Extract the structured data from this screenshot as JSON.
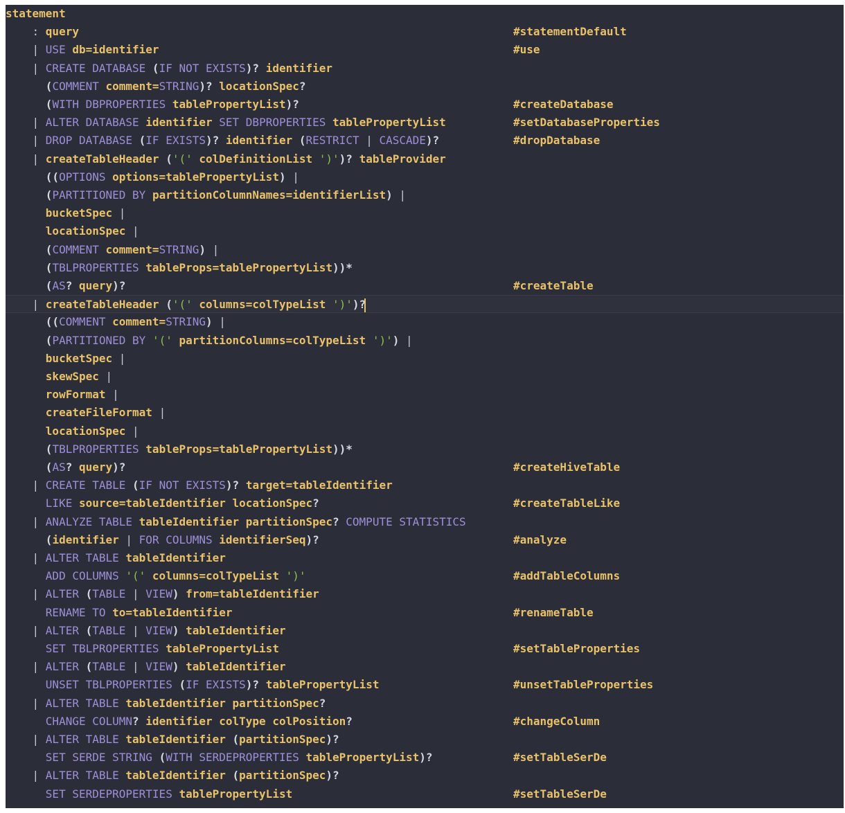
{
  "editor": {
    "lines": [
      {
        "indent": "",
        "tokens": [
          [
            "r",
            "statement"
          ]
        ],
        "label": ""
      },
      {
        "indent": "    ",
        "tokens": [
          [
            "s",
            ": "
          ],
          [
            "r",
            "query"
          ]
        ],
        "label": "#statementDefault"
      },
      {
        "indent": "    ",
        "tokens": [
          [
            "s",
            "| "
          ],
          [
            "k",
            "USE "
          ],
          [
            "r",
            "db=identifier"
          ]
        ],
        "label": "#use"
      },
      {
        "indent": "    ",
        "tokens": [
          [
            "s",
            "| "
          ],
          [
            "k",
            "CREATE DATABASE "
          ],
          [
            "p",
            "("
          ],
          [
            "k",
            "IF NOT EXISTS"
          ],
          [
            "p",
            ")? "
          ],
          [
            "r",
            "identifier"
          ]
        ],
        "label": ""
      },
      {
        "indent": "      ",
        "tokens": [
          [
            "p",
            "("
          ],
          [
            "k",
            "COMMENT "
          ],
          [
            "r",
            "comment="
          ],
          [
            "k",
            "STRING"
          ],
          [
            "p",
            ")? "
          ],
          [
            "r",
            "locationSpec"
          ],
          [
            "p",
            "?"
          ]
        ],
        "label": ""
      },
      {
        "indent": "      ",
        "tokens": [
          [
            "p",
            "("
          ],
          [
            "k",
            "WITH DBPROPERTIES "
          ],
          [
            "r",
            "tablePropertyList"
          ],
          [
            "p",
            ")?"
          ]
        ],
        "label": "#createDatabase"
      },
      {
        "indent": "    ",
        "tokens": [
          [
            "s",
            "| "
          ],
          [
            "k",
            "ALTER DATABASE "
          ],
          [
            "r",
            "identifier "
          ],
          [
            "k",
            "SET DBPROPERTIES "
          ],
          [
            "r",
            "tablePropertyList"
          ]
        ],
        "label": "#setDatabaseProperties"
      },
      {
        "indent": "    ",
        "tokens": [
          [
            "s",
            "| "
          ],
          [
            "k",
            "DROP DATABASE "
          ],
          [
            "p",
            "("
          ],
          [
            "k",
            "IF EXISTS"
          ],
          [
            "p",
            ")? "
          ],
          [
            "r",
            "identifier "
          ],
          [
            "p",
            "("
          ],
          [
            "k",
            "RESTRICT "
          ],
          [
            "s",
            "| "
          ],
          [
            "k",
            "CASCADE"
          ],
          [
            "p",
            ")?"
          ]
        ],
        "label": "#dropDatabase"
      },
      {
        "indent": "    ",
        "tokens": [
          [
            "s",
            "| "
          ],
          [
            "r",
            "createTableHeader "
          ],
          [
            "p",
            "("
          ],
          [
            "t",
            "'(' "
          ],
          [
            "r",
            "colDefinitionList "
          ],
          [
            "t",
            "')'"
          ],
          [
            "p",
            ")? "
          ],
          [
            "r",
            "tableProvider"
          ]
        ],
        "label": ""
      },
      {
        "indent": "      ",
        "tokens": [
          [
            "p",
            "(("
          ],
          [
            "k",
            "OPTIONS "
          ],
          [
            "r",
            "options=tablePropertyList"
          ],
          [
            "p",
            ") "
          ],
          [
            "s",
            "|"
          ]
        ],
        "label": ""
      },
      {
        "indent": "      ",
        "tokens": [
          [
            "p",
            "("
          ],
          [
            "k",
            "PARTITIONED BY "
          ],
          [
            "r",
            "partitionColumnNames=identifierList"
          ],
          [
            "p",
            ") "
          ],
          [
            "s",
            "|"
          ]
        ],
        "label": ""
      },
      {
        "indent": "      ",
        "tokens": [
          [
            "r",
            "bucketSpec "
          ],
          [
            "s",
            "|"
          ]
        ],
        "label": ""
      },
      {
        "indent": "      ",
        "tokens": [
          [
            "r",
            "locationSpec "
          ],
          [
            "s",
            "|"
          ]
        ],
        "label": ""
      },
      {
        "indent": "      ",
        "tokens": [
          [
            "p",
            "("
          ],
          [
            "k",
            "COMMENT "
          ],
          [
            "r",
            "comment="
          ],
          [
            "k",
            "STRING"
          ],
          [
            "p",
            ") "
          ],
          [
            "s",
            "|"
          ]
        ],
        "label": ""
      },
      {
        "indent": "      ",
        "tokens": [
          [
            "p",
            "("
          ],
          [
            "k",
            "TBLPROPERTIES "
          ],
          [
            "r",
            "tableProps=tablePropertyList"
          ],
          [
            "p",
            "))*"
          ]
        ],
        "label": ""
      },
      {
        "indent": "      ",
        "tokens": [
          [
            "p",
            "("
          ],
          [
            "k",
            "AS"
          ],
          [
            "p",
            "? "
          ],
          [
            "r",
            "query"
          ],
          [
            "p",
            ")?"
          ]
        ],
        "label": "#createTable"
      },
      {
        "indent": "    ",
        "tokens": [
          [
            "s",
            "| "
          ],
          [
            "r",
            "createTableHeader "
          ],
          [
            "p",
            "("
          ],
          [
            "t",
            "'(' "
          ],
          [
            "r",
            "columns=colTypeList "
          ],
          [
            "t",
            "')'"
          ],
          [
            "p",
            ")?"
          ]
        ],
        "label": "",
        "current": true
      },
      {
        "indent": "      ",
        "tokens": [
          [
            "p",
            "(("
          ],
          [
            "k",
            "COMMENT "
          ],
          [
            "r",
            "comment="
          ],
          [
            "k",
            "STRING"
          ],
          [
            "p",
            ") "
          ],
          [
            "s",
            "|"
          ]
        ],
        "label": ""
      },
      {
        "indent": "      ",
        "tokens": [
          [
            "p",
            "("
          ],
          [
            "k",
            "PARTITIONED BY "
          ],
          [
            "t",
            "'(' "
          ],
          [
            "r",
            "partitionColumns=colTypeList "
          ],
          [
            "t",
            "')'"
          ],
          [
            "p",
            ") "
          ],
          [
            "s",
            "|"
          ]
        ],
        "label": ""
      },
      {
        "indent": "      ",
        "tokens": [
          [
            "r",
            "bucketSpec "
          ],
          [
            "s",
            "|"
          ]
        ],
        "label": ""
      },
      {
        "indent": "      ",
        "tokens": [
          [
            "r",
            "skewSpec "
          ],
          [
            "s",
            "|"
          ]
        ],
        "label": ""
      },
      {
        "indent": "      ",
        "tokens": [
          [
            "r",
            "rowFormat "
          ],
          [
            "s",
            "|"
          ]
        ],
        "label": ""
      },
      {
        "indent": "      ",
        "tokens": [
          [
            "r",
            "createFileFormat "
          ],
          [
            "s",
            "|"
          ]
        ],
        "label": ""
      },
      {
        "indent": "      ",
        "tokens": [
          [
            "r",
            "locationSpec "
          ],
          [
            "s",
            "|"
          ]
        ],
        "label": ""
      },
      {
        "indent": "      ",
        "tokens": [
          [
            "p",
            "("
          ],
          [
            "k",
            "TBLPROPERTIES "
          ],
          [
            "r",
            "tableProps=tablePropertyList"
          ],
          [
            "p",
            "))*"
          ]
        ],
        "label": ""
      },
      {
        "indent": "      ",
        "tokens": [
          [
            "p",
            "("
          ],
          [
            "k",
            "AS"
          ],
          [
            "p",
            "? "
          ],
          [
            "r",
            "query"
          ],
          [
            "p",
            ")?"
          ]
        ],
        "label": "#createHiveTable"
      },
      {
        "indent": "    ",
        "tokens": [
          [
            "s",
            "| "
          ],
          [
            "k",
            "CREATE TABLE "
          ],
          [
            "p",
            "("
          ],
          [
            "k",
            "IF NOT EXISTS"
          ],
          [
            "p",
            ")? "
          ],
          [
            "r",
            "target=tableIdentifier"
          ]
        ],
        "label": ""
      },
      {
        "indent": "      ",
        "tokens": [
          [
            "k",
            "LIKE "
          ],
          [
            "r",
            "source=tableIdentifier locationSpec"
          ],
          [
            "p",
            "?"
          ]
        ],
        "label": "#createTableLike"
      },
      {
        "indent": "    ",
        "tokens": [
          [
            "s",
            "| "
          ],
          [
            "k",
            "ANALYZE TABLE "
          ],
          [
            "r",
            "tableIdentifier partitionSpec"
          ],
          [
            "p",
            "? "
          ],
          [
            "k",
            "COMPUTE STATISTICS"
          ]
        ],
        "label": ""
      },
      {
        "indent": "      ",
        "tokens": [
          [
            "p",
            "("
          ],
          [
            "r",
            "identifier "
          ],
          [
            "s",
            "| "
          ],
          [
            "k",
            "FOR COLUMNS "
          ],
          [
            "r",
            "identifierSeq"
          ],
          [
            "p",
            ")?"
          ]
        ],
        "label": "#analyze"
      },
      {
        "indent": "    ",
        "tokens": [
          [
            "s",
            "| "
          ],
          [
            "k",
            "ALTER TABLE "
          ],
          [
            "r",
            "tableIdentifier"
          ]
        ],
        "label": ""
      },
      {
        "indent": "      ",
        "tokens": [
          [
            "k",
            "ADD COLUMNS "
          ],
          [
            "t",
            "'(' "
          ],
          [
            "r",
            "columns=colTypeList "
          ],
          [
            "t",
            "')'"
          ]
        ],
        "label": "#addTableColumns"
      },
      {
        "indent": "    ",
        "tokens": [
          [
            "s",
            "| "
          ],
          [
            "k",
            "ALTER "
          ],
          [
            "p",
            "("
          ],
          [
            "k",
            "TABLE "
          ],
          [
            "s",
            "| "
          ],
          [
            "k",
            "VIEW"
          ],
          [
            "p",
            ") "
          ],
          [
            "r",
            "from=tableIdentifier"
          ]
        ],
        "label": ""
      },
      {
        "indent": "      ",
        "tokens": [
          [
            "k",
            "RENAME TO "
          ],
          [
            "r",
            "to=tableIdentifier"
          ]
        ],
        "label": "#renameTable"
      },
      {
        "indent": "    ",
        "tokens": [
          [
            "s",
            "| "
          ],
          [
            "k",
            "ALTER "
          ],
          [
            "p",
            "("
          ],
          [
            "k",
            "TABLE "
          ],
          [
            "s",
            "| "
          ],
          [
            "k",
            "VIEW"
          ],
          [
            "p",
            ") "
          ],
          [
            "r",
            "tableIdentifier"
          ]
        ],
        "label": ""
      },
      {
        "indent": "      ",
        "tokens": [
          [
            "k",
            "SET TBLPROPERTIES "
          ],
          [
            "r",
            "tablePropertyList"
          ]
        ],
        "label": "#setTableProperties"
      },
      {
        "indent": "    ",
        "tokens": [
          [
            "s",
            "| "
          ],
          [
            "k",
            "ALTER "
          ],
          [
            "p",
            "("
          ],
          [
            "k",
            "TABLE "
          ],
          [
            "s",
            "| "
          ],
          [
            "k",
            "VIEW"
          ],
          [
            "p",
            ") "
          ],
          [
            "r",
            "tableIdentifier"
          ]
        ],
        "label": ""
      },
      {
        "indent": "      ",
        "tokens": [
          [
            "k",
            "UNSET TBLPROPERTIES "
          ],
          [
            "p",
            "("
          ],
          [
            "k",
            "IF EXISTS"
          ],
          [
            "p",
            ")? "
          ],
          [
            "r",
            "tablePropertyList"
          ]
        ],
        "label": "#unsetTableProperties"
      },
      {
        "indent": "    ",
        "tokens": [
          [
            "s",
            "| "
          ],
          [
            "k",
            "ALTER TABLE "
          ],
          [
            "r",
            "tableIdentifier partitionSpec"
          ],
          [
            "p",
            "?"
          ]
        ],
        "label": ""
      },
      {
        "indent": "      ",
        "tokens": [
          [
            "k",
            "CHANGE COLUMN"
          ],
          [
            "p",
            "? "
          ],
          [
            "r",
            "identifier colType colPosition"
          ],
          [
            "p",
            "?"
          ]
        ],
        "label": "#changeColumn"
      },
      {
        "indent": "    ",
        "tokens": [
          [
            "s",
            "| "
          ],
          [
            "k",
            "ALTER TABLE "
          ],
          [
            "r",
            "tableIdentifier "
          ],
          [
            "p",
            "("
          ],
          [
            "r",
            "partitionSpec"
          ],
          [
            "p",
            ")?"
          ]
        ],
        "label": ""
      },
      {
        "indent": "      ",
        "tokens": [
          [
            "k",
            "SET SERDE STRING "
          ],
          [
            "p",
            "("
          ],
          [
            "k",
            "WITH SERDEPROPERTIES "
          ],
          [
            "r",
            "tablePropertyList"
          ],
          [
            "p",
            ")?"
          ]
        ],
        "label": "#setTableSerDe"
      },
      {
        "indent": "    ",
        "tokens": [
          [
            "s",
            "| "
          ],
          [
            "k",
            "ALTER TABLE "
          ],
          [
            "r",
            "tableIdentifier "
          ],
          [
            "p",
            "("
          ],
          [
            "r",
            "partitionSpec"
          ],
          [
            "p",
            ")?"
          ]
        ],
        "label": ""
      },
      {
        "indent": "      ",
        "tokens": [
          [
            "k",
            "SET SERDEPROPERTIES "
          ],
          [
            "r",
            "tablePropertyList"
          ]
        ],
        "label": "#setTableSerDe"
      }
    ]
  },
  "theme": {
    "background": "#2b2d38",
    "rule_color": "#e9c26a",
    "keyword_color": "#9f8fd8",
    "string_color": "#8cc04d",
    "label_color": "#e9c26a"
  }
}
